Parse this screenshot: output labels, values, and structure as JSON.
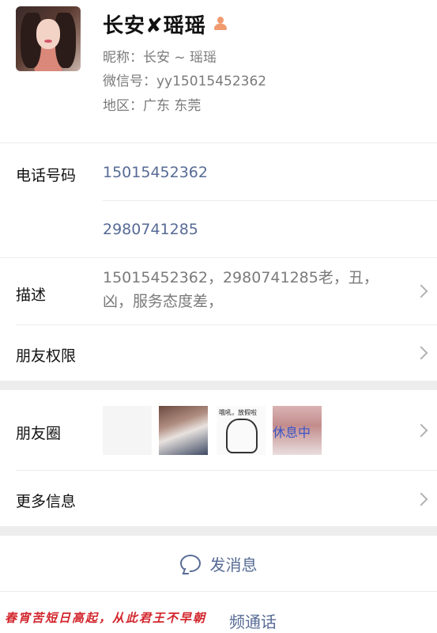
{
  "profile": {
    "name": "长安✘瑶瑶",
    "nickname_label": "昵称：",
    "nickname": "长安 ~ 瑶瑶",
    "wechat_label": "微信号：",
    "wechat_id": "yy15015452362",
    "region_label": "地区：",
    "region": "广东  东莞"
  },
  "phone": {
    "label": "电话号码",
    "numbers": [
      "15015452362",
      "2980741285"
    ]
  },
  "description": {
    "label": "描述",
    "text": "15015452362，2980741285老，丑，凶，服务态度差，"
  },
  "permissions": {
    "label": "朋友权限"
  },
  "moments": {
    "label": "朋友圈",
    "thumb3_caption": "哦吼，放假啦",
    "thumb4_text": "休息中"
  },
  "more": {
    "label": "更多信息"
  },
  "actions": {
    "message_label": "发消息",
    "call_label": "频通话"
  },
  "watermark": "春宵苦短日高起，从此君王不早朝",
  "colors": {
    "link": "#576b95",
    "watermark": "#d2252c",
    "gap": "#ededed"
  },
  "icons": [
    "gender-female-icon",
    "chevron-right-icon",
    "chat-bubble-icon"
  ]
}
